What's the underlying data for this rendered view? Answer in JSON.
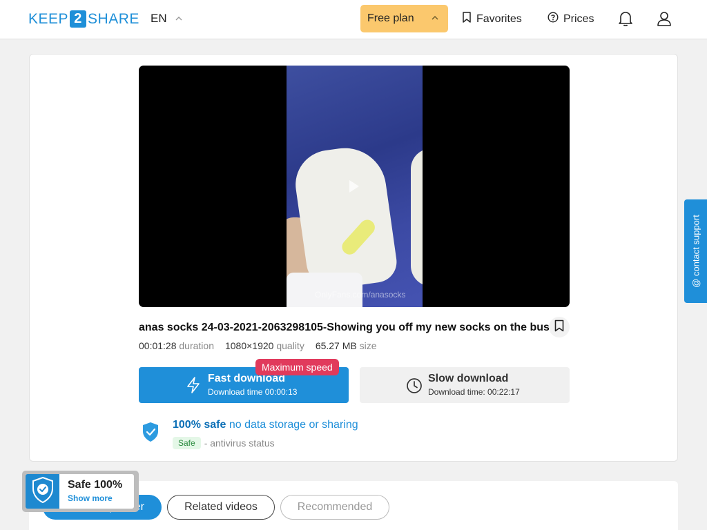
{
  "header": {
    "logo_left": "KEEP",
    "logo_num": "2",
    "logo_right": "SHARE",
    "language": "EN",
    "plan_label": "Free plan",
    "favorites_label": "Favorites",
    "prices_label": "Prices"
  },
  "video": {
    "watermark": "OnlyFans.com/anasocks"
  },
  "file": {
    "title": "anas socks 24-03-2021-2063298105-Showing you off my new socks on the bus",
    "duration": "00:01:28",
    "duration_label": "duration",
    "resolution": "1080×1920",
    "resolution_label": "quality",
    "size": "65.27 MB",
    "size_label": "size"
  },
  "download": {
    "fast_label": "Fast download",
    "fast_time": "Download time 00:00:13",
    "badge": "Maximum speed",
    "slow_label": "Slow download",
    "slow_time": "Download time: 00:22:17"
  },
  "safety": {
    "bold": "100% safe",
    "rest": "no data storage or sharing",
    "tag": "Safe",
    "status": "- antivirus status"
  },
  "support": {
    "label": "@ contact support"
  },
  "tabs": [
    {
      "label": "From this partner"
    },
    {
      "label": "Related videos"
    },
    {
      "label": "Recommended"
    }
  ],
  "safe_badge": {
    "title": "Safe 100%",
    "link": "Show more"
  },
  "colors": {
    "accent": "#1f8fd9",
    "plan_bg": "#fbc86d",
    "badge_red": "#e13a5c"
  }
}
